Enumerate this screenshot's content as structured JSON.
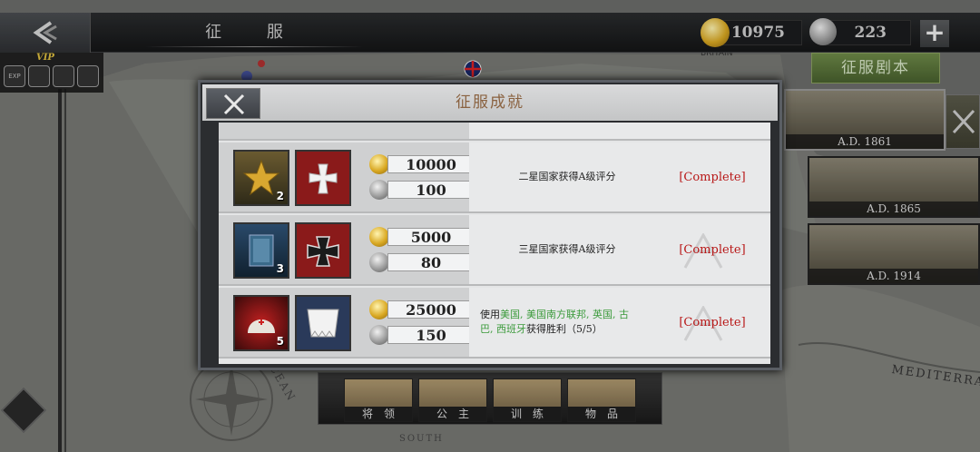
{
  "header": {
    "title": "征 服",
    "gold_amount": "10975",
    "medal_amount": "223",
    "plus_label": "+"
  },
  "vip": {
    "label": "VIP",
    "badges": [
      "EXP",
      "",
      "",
      ""
    ]
  },
  "right_panel": {
    "script_button": "征服剧本",
    "eras": [
      "A.D. 1861",
      "A.D. 1865",
      "A.D. 1914"
    ]
  },
  "map_labels": {
    "britain": "BRITAIN",
    "ocean": "OCEAN",
    "mediterranean": "MEDITERRAN",
    "south": "SOUTH"
  },
  "bottom_tabs": [
    "将领",
    "公主",
    "训练",
    "物品"
  ],
  "dialog": {
    "title": "征服成就",
    "rows": [
      {
        "gold": "10000",
        "silver": "100",
        "desc_plain": "二星国家获得A级评分",
        "status": "[Complete]",
        "item1_count": "2"
      },
      {
        "gold": "5000",
        "silver": "80",
        "desc_plain": "三星国家获得A级评分",
        "status": "[Complete]",
        "item1_count": "3"
      },
      {
        "gold": "25000",
        "silver": "150",
        "desc_prefix": "使用",
        "desc_countries": "美国, 美国南方联邦, 英国, 古巴, 西班牙",
        "desc_suffix": "获得胜利（5/5）",
        "status": "[Complete]",
        "item1_count": "5"
      }
    ]
  },
  "colors": {
    "complete_red": "#b81818",
    "country_green": "#3a9a3a",
    "title_brown": "#8a6240",
    "script_green": "#5c7a3c"
  }
}
